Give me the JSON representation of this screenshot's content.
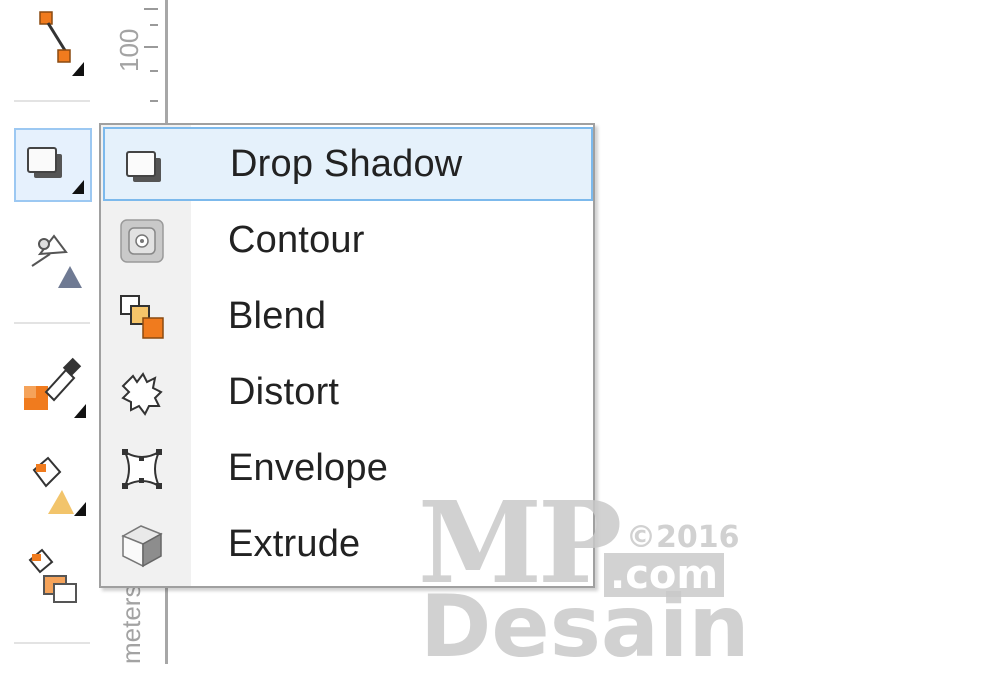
{
  "toolbox": {
    "tools": [
      {
        "icon": "connector-tool-icon"
      },
      {
        "icon": "drop-shadow-tool-icon",
        "active": true
      },
      {
        "icon": "transparency-tool-icon"
      },
      {
        "icon": "color-eyedropper-icon"
      },
      {
        "icon": "interactive-fill-icon"
      },
      {
        "icon": "smart-fill-icon"
      }
    ]
  },
  "ruler": {
    "label_100": "100",
    "unit_text": "meters"
  },
  "flyout": {
    "items": [
      {
        "label": "Drop Shadow",
        "icon": "drop-shadow-icon",
        "selected": true
      },
      {
        "label": "Contour",
        "icon": "contour-icon"
      },
      {
        "label": "Blend",
        "icon": "blend-icon"
      },
      {
        "label": "Distort",
        "icon": "distort-icon"
      },
      {
        "label": "Envelope",
        "icon": "envelope-icon"
      },
      {
        "label": "Extrude",
        "icon": "extrude-icon"
      }
    ]
  },
  "watermark": {
    "brand": "MP",
    "year": "©2016",
    "domain": ".com",
    "name": "Desain"
  },
  "colors": {
    "selection_fill": "#e5f1fb",
    "selection_border": "#7cb9ec",
    "accent_orange": "#f07b1e"
  }
}
